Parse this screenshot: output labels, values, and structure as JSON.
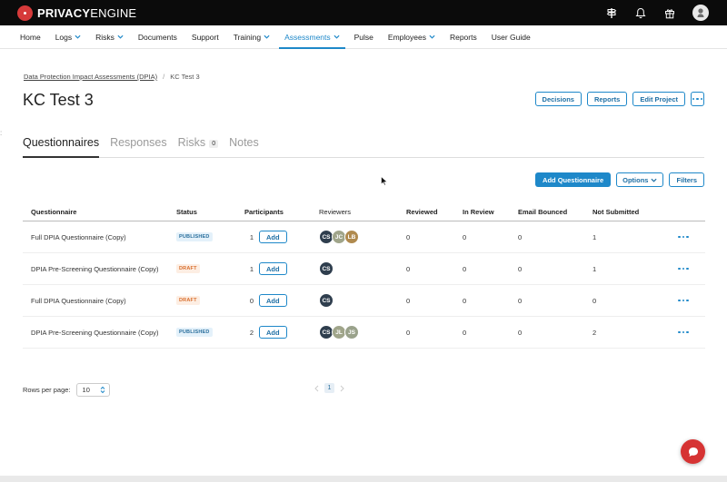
{
  "brand": {
    "name_bold": "PRIVACY",
    "name_thin": "ENGINE",
    "logo_color": "#d63a3a"
  },
  "topbar_icons": [
    "signpost-icon",
    "bell-icon",
    "gift-icon",
    "user-avatar"
  ],
  "nav": {
    "items": [
      {
        "label": "Home",
        "dropdown": false
      },
      {
        "label": "Logs",
        "dropdown": true
      },
      {
        "label": "Risks",
        "dropdown": true
      },
      {
        "label": "Documents",
        "dropdown": false
      },
      {
        "label": "Support",
        "dropdown": false
      },
      {
        "label": "Training",
        "dropdown": true
      },
      {
        "label": "Assessments",
        "dropdown": true,
        "active": true
      },
      {
        "label": "Pulse",
        "dropdown": false
      },
      {
        "label": "Employees",
        "dropdown": true
      },
      {
        "label": "Reports",
        "dropdown": false
      },
      {
        "label": "User Guide",
        "dropdown": false
      }
    ]
  },
  "left_marker": ":",
  "breadcrumb": {
    "parent": "Data Protection Impact Assessments (DPIA)",
    "separator": "/",
    "current": "KC Test 3"
  },
  "page": {
    "title": "KC Test 3"
  },
  "header_buttons": {
    "decisions": "Decisions",
    "reports": "Reports",
    "edit_project": "Edit Project"
  },
  "tabs": {
    "questionnaires": "Questionnaires",
    "responses": "Responses",
    "risks": "Risks",
    "risks_count": "0",
    "notes": "Notes"
  },
  "actions": {
    "add_questionnaire": "Add Questionnaire",
    "options": "Options",
    "filters": "Filters"
  },
  "table": {
    "headers": {
      "questionnaire": "Questionnaire",
      "status": "Status",
      "participants": "Participants",
      "reviewers": "Reviewers",
      "reviewed": "Reviewed",
      "in_review": "In Review",
      "email_bounced": "Email Bounced",
      "not_submitted": "Not Submitted"
    },
    "add_label": "Add",
    "rows": [
      {
        "questionnaire": "Full DPIA Questionnaire (Copy)",
        "status": "PUBLISHED",
        "participants": "1",
        "reviewers": [
          {
            "initials": "CS",
            "color": "#2f3e4e"
          },
          {
            "initials": "JC",
            "color": "#a0a58a"
          },
          {
            "initials": "LB",
            "color": "#b08a4e"
          }
        ],
        "reviewed": "0",
        "in_review": "0",
        "email_bounced": "0",
        "not_submitted": "1"
      },
      {
        "questionnaire": "DPIA Pre-Screening Questionnaire (Copy)",
        "status": "DRAFT",
        "participants": "1",
        "reviewers": [
          {
            "initials": "CS",
            "color": "#2f3e4e"
          }
        ],
        "reviewed": "0",
        "in_review": "0",
        "email_bounced": "0",
        "not_submitted": "1"
      },
      {
        "questionnaire": "Full DPIA Questionnaire (Copy)",
        "status": "DRAFT",
        "participants": "0",
        "reviewers": [
          {
            "initials": "CS",
            "color": "#2f3e4e"
          }
        ],
        "reviewed": "0",
        "in_review": "0",
        "email_bounced": "0",
        "not_submitted": "0"
      },
      {
        "questionnaire": "DPIA Pre-Screening Questionnaire (Copy)",
        "status": "PUBLISHED",
        "participants": "2",
        "reviewers": [
          {
            "initials": "CS",
            "color": "#2f3e4e"
          },
          {
            "initials": "JL",
            "color": "#a0a58a"
          },
          {
            "initials": "JS",
            "color": "#9aa28b"
          }
        ],
        "reviewed": "0",
        "in_review": "0",
        "email_bounced": "0",
        "not_submitted": "2"
      }
    ]
  },
  "footer": {
    "rows_per_page_label": "Rows per page:",
    "rows_per_page_value": "10",
    "current_page": "1"
  },
  "colors": {
    "accent": "#1e88c9",
    "chat": "#d63333",
    "topbar": "#0b0b0b"
  }
}
